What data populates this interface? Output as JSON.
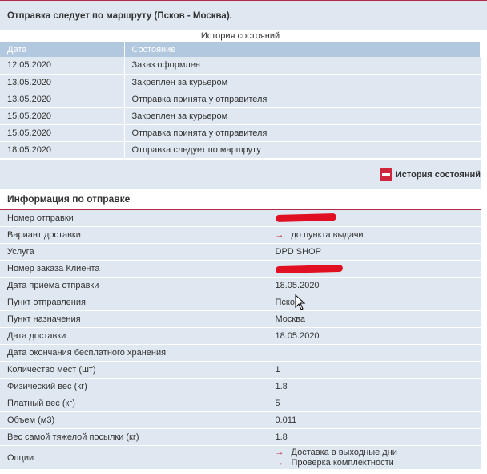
{
  "status": {
    "text": "Отправка следует по маршруту (Псков - Москва)."
  },
  "history": {
    "caption": "История состояний",
    "columns": [
      "Дата",
      "Состояние"
    ],
    "rows": [
      {
        "date": "12.05.2020",
        "state": "Заказ оформлен"
      },
      {
        "date": "13.05.2020",
        "state": "Закреплен за курьером"
      },
      {
        "date": "13.05.2020",
        "state": "Отправка принята у отправителя"
      },
      {
        "date": "15.05.2020",
        "state": "Закреплен за курьером"
      },
      {
        "date": "15.05.2020",
        "state": "Отправка принята у отправителя"
      },
      {
        "date": "18.05.2020",
        "state": "Отправка следует по маршруту"
      }
    ],
    "toggle_label": "История состояний"
  },
  "info": {
    "title": "Информация по отправке",
    "rows": [
      {
        "label": "Номер отправки",
        "value": ""
      },
      {
        "label": "Вариант доставки",
        "value": "до пункта выдачи"
      },
      {
        "label": "Услуга",
        "value": "DPD SHOP"
      },
      {
        "label": "Номер заказа Клиента",
        "value": ""
      },
      {
        "label": "Дата приема отправки",
        "value": "18.05.2020"
      },
      {
        "label": "Пункт отправления",
        "value": "Псков"
      },
      {
        "label": "Пункт назначения",
        "value": "Москва"
      },
      {
        "label": "Дата доставки",
        "value": "18.05.2020"
      },
      {
        "label": "Дата окончания бесплатного хранения",
        "value": ""
      },
      {
        "label": "Количество мест (шт)",
        "value": "1"
      },
      {
        "label": "Физический вес (кг)",
        "value": "1.8"
      },
      {
        "label": "Платный вес (кг)",
        "value": "5"
      },
      {
        "label": "Объем (м3)",
        "value": "0.011"
      },
      {
        "label": "Вес самой тяжелой посылки (кг)",
        "value": "1.8"
      },
      {
        "label": "Опции",
        "options": [
          "Доставка в выходные дни",
          "Проверка комплектности"
        ]
      }
    ]
  },
  "colors": {
    "accent": "#b02a49",
    "row_bg": "#dfe8f1",
    "header_bg": "#b2c8de",
    "arrow": "#cc1f3b",
    "redaction": "#e01022"
  },
  "icons": {
    "toggle": "minus-box-icon",
    "bullet": "arrow-right-icon",
    "cursor": "mouse-pointer-icon"
  }
}
